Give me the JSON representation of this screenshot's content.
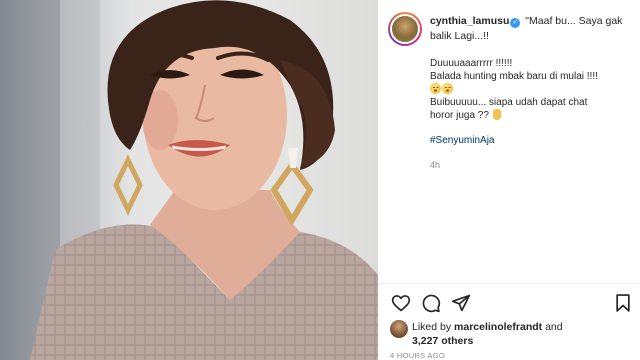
{
  "post": {
    "username": "cynthia_lamusu",
    "caption_head": "\"Maaf bu... Saya gak balik Lagi...!!",
    "caption_lines": [
      "Duuuuaaarrrrr !!!!!!",
      "Balada hunting mbak baru di mulai !!!!",
      "Buibuuuuu... siapa udah dapat chat",
      "horor juga ??"
    ],
    "hashtag": "#SenyuminAja",
    "time_ago": "4h",
    "likes_prefix": "Liked by",
    "liked_by_user": "marcelinolefrandt",
    "likes_and": "and",
    "likes_count": "3,227 others",
    "timestamp": "4 HOURS AGO"
  },
  "icons": {
    "verified": "verified-badge-icon",
    "like": "heart-icon",
    "comment": "comment-icon",
    "share": "paper-plane-icon",
    "save": "bookmark-icon"
  },
  "colors": {
    "verified": "#3897f0",
    "hashtag": "#00376b",
    "muted": "#8e8e8e",
    "text": "#262626"
  }
}
